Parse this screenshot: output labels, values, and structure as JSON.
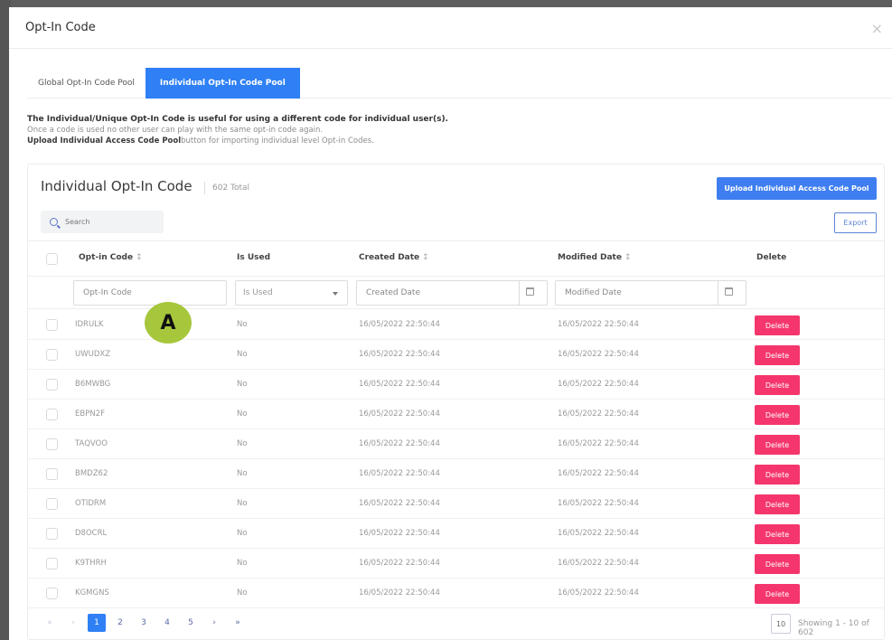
{
  "modal": {
    "title": "Opt-In Code",
    "close_icon": "×"
  },
  "tabs": [
    {
      "label": "Global Opt-In Code Pool",
      "active": false
    },
    {
      "label": "Individual Opt-In Code Pool",
      "active": true
    }
  ],
  "description": {
    "line1": "The Individual/Unique Opt-In Code is useful for using a different code for individual user(s).",
    "line2": "Once a code is used no other user can play with the same opt-in code again.",
    "line3_bold": "Upload Individual Access Code Pool",
    "line3_rest": "button for importing individual level Opt-in Codes."
  },
  "card": {
    "title": "Individual Opt-In Code",
    "total": "602 Total",
    "upload_label": "Upload Individual Access Code Pool",
    "search_placeholder": "Search",
    "export_label": "Export"
  },
  "table": {
    "columns": [
      "Opt-in Code",
      "Is Used",
      "Created Date",
      "Modified Date",
      "Delete"
    ],
    "sort_glyph": "↕",
    "filters": {
      "code_placeholder": "Opt-In Code",
      "used_value": "Is Used",
      "created_placeholder": "Created Date",
      "modified_placeholder": "Modified Date"
    },
    "delete_label": "Delete",
    "rows": [
      {
        "code": "IDRULK",
        "used": "No",
        "created": "16/05/2022 22:50:44",
        "modified": "16/05/2022 22:50:44"
      },
      {
        "code": "UWUDXZ",
        "used": "No",
        "created": "16/05/2022 22:50:44",
        "modified": "16/05/2022 22:50:44"
      },
      {
        "code": "B6MWBG",
        "used": "No",
        "created": "16/05/2022 22:50:44",
        "modified": "16/05/2022 22:50:44"
      },
      {
        "code": "EBPN2F",
        "used": "No",
        "created": "16/05/2022 22:50:44",
        "modified": "16/05/2022 22:50:44"
      },
      {
        "code": "TAQVOO",
        "used": "No",
        "created": "16/05/2022 22:50:44",
        "modified": "16/05/2022 22:50:44"
      },
      {
        "code": "BMDZ62",
        "used": "No",
        "created": "16/05/2022 22:50:44",
        "modified": "16/05/2022 22:50:44"
      },
      {
        "code": "OTIDRM",
        "used": "No",
        "created": "16/05/2022 22:50:44",
        "modified": "16/05/2022 22:50:44"
      },
      {
        "code": "D8OCRL",
        "used": "No",
        "created": "16/05/2022 22:50:44",
        "modified": "16/05/2022 22:50:44"
      },
      {
        "code": "K9THRH",
        "used": "No",
        "created": "16/05/2022 22:50:44",
        "modified": "16/05/2022 22:50:44"
      },
      {
        "code": "KGMGNS",
        "used": "No",
        "created": "16/05/2022 22:50:44",
        "modified": "16/05/2022 22:50:44"
      }
    ]
  },
  "pagination": {
    "first": "«",
    "prev": "‹",
    "pages": [
      "1",
      "2",
      "3",
      "4",
      "5"
    ],
    "current": "1",
    "next": "›",
    "last": "»",
    "per_page": "10",
    "showing": "Showing 1 - 10 of 602"
  },
  "annotation": {
    "label": "A"
  },
  "colors": {
    "primary": "#2f80f5",
    "delete": "#f5366c",
    "annotation": "#a6c73c"
  }
}
